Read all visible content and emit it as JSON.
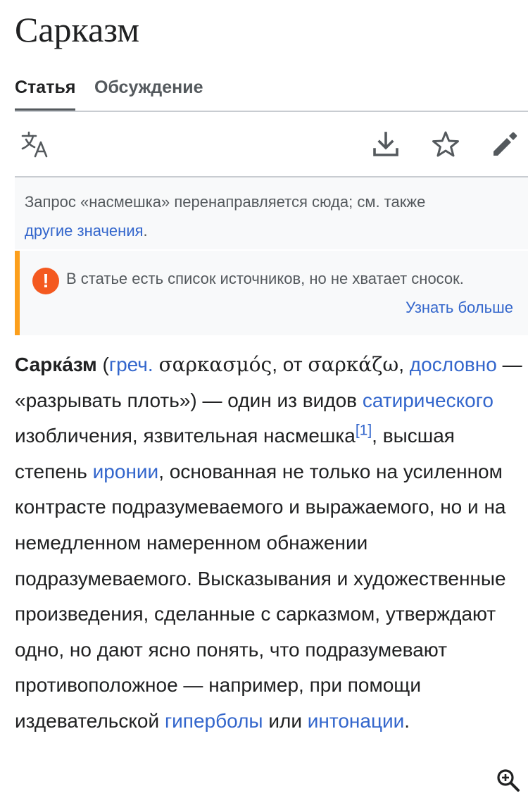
{
  "page": {
    "title": "Сарказм"
  },
  "tabs": [
    {
      "label": "Статья",
      "active": true
    },
    {
      "label": "Обсуждение",
      "active": false
    }
  ],
  "toolbar": {
    "icons": [
      "translate-icon",
      "download-icon",
      "star-icon",
      "pencil-icon"
    ]
  },
  "hatnote": {
    "text": "Запрос «насмешка» перенаправляется сюда; см. также",
    "link": "другие значения",
    "end": "."
  },
  "ambox": {
    "icon_glyph": "!",
    "text": "В статье есть список источников, но не хватает сносок.",
    "more_link": "Узнать больше",
    "accent_color": "#fc9f1c",
    "icon_color": "#f4591f"
  },
  "article": {
    "term": "Сарка́зм",
    "open_paren": " (",
    "link_greek": "греч.",
    "greek_word1": "σαρκασμός",
    "from": ", от ",
    "greek_word2": "σαρκάζω",
    "comma": ",",
    "link_literally": "дословно",
    "literal_meaning": " — «разрывать плоть») — один из видов ",
    "link_satirical": "сатирического",
    "text_after_satirical": " изобличения, язвительная насмешка",
    "ref1": "[1]",
    "text_after_ref": ", высшая степень ",
    "link_irony": "иронии",
    "text_main": ", основанная не только на усиленном контрасте подразумеваемого и выражаемого, но и на немедленном намеренном обнажении подразумеваемого. Высказывания и художественные произведения, сделанные с сарказмом, утверждают одно, но дают ясно понять, что подразумевают противоположное — например, при помощи издевательской ",
    "link_hyperbole": "гиперболы",
    "or": " или ",
    "link_intonation": "интонации",
    "period": "."
  },
  "colors": {
    "link": "#3366cc",
    "text": "#202122",
    "muted": "#54595d"
  }
}
